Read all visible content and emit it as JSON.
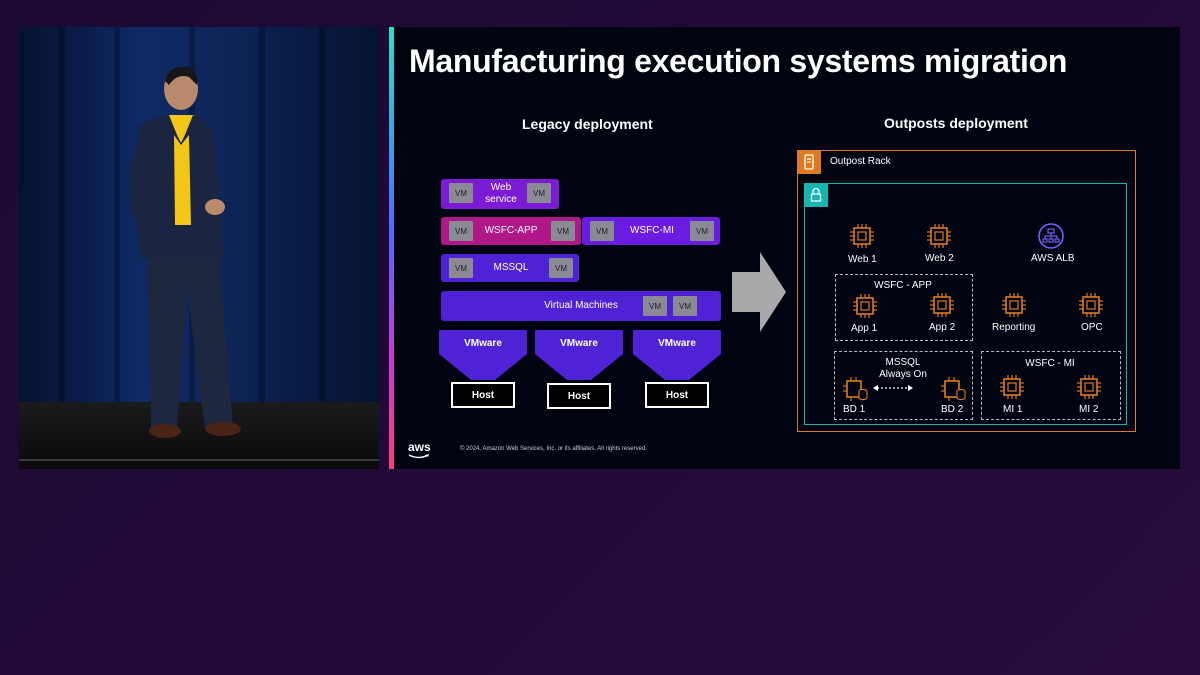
{
  "slide": {
    "title": "Manufacturing execution systems migration",
    "copyright": "© 2024, Amazon Web Services, Inc. or its affiliates. All rights reserved.",
    "logo_text": "aws"
  },
  "legacy": {
    "heading": "Legacy deployment",
    "vm_label": "VM",
    "web_service": "Web service",
    "wsfc_app": "WSFC-APP",
    "wsfc_mi": "WSFC-MI",
    "mssql": "MSSQL",
    "virtual_machines": "Virtual Machines",
    "vmware": [
      "VMware",
      "VMware",
      "VMware"
    ],
    "host": [
      "Host",
      "Host",
      "Host"
    ]
  },
  "outposts": {
    "heading": "Outposts deployment",
    "rack_label": "Outpost Rack",
    "web1": "Web 1",
    "web2": "Web 2",
    "alb": "AWS ALB",
    "wsfc_app_group": "WSFC - APP",
    "app1": "App 1",
    "app2": "App 2",
    "reporting": "Reporting",
    "opc": "OPC",
    "mssql_group_line1": "MSSQL",
    "mssql_group_line2": "Always On",
    "bd1": "BD 1",
    "bd2": "BD 2",
    "wsfc_mi_group": "WSFC - MI",
    "mi1": "MI 1",
    "mi2": "MI 2"
  },
  "colors": {
    "accent_orange": "#e07a1f",
    "accent_teal": "#16b7b0",
    "vm_purple": "#7b1cd4",
    "vm_magenta": "#b01789",
    "vm_blue": "#4f22d6"
  },
  "icons": [
    "ec2-instance-icon",
    "load-balancer-icon",
    "outpost-icon",
    "lock-icon",
    "database-icon"
  ]
}
